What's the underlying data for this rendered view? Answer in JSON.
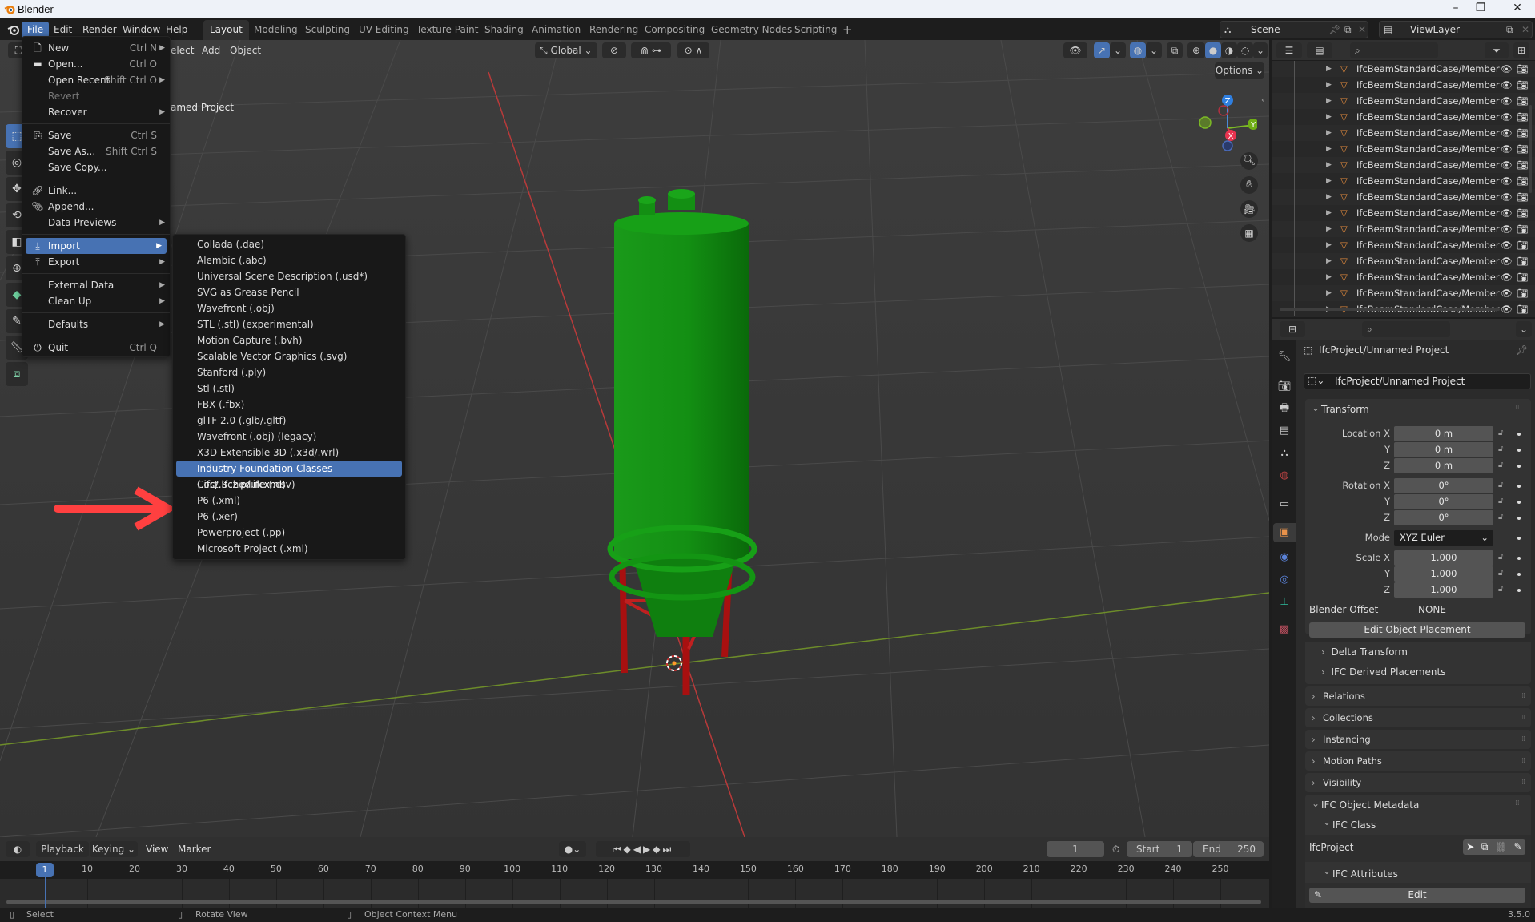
{
  "window": {
    "title": "Blender",
    "controls": {
      "minimize": "–",
      "maximize": "❐",
      "close": "✕"
    }
  },
  "topbar": {
    "menus": [
      "File",
      "Edit",
      "Render",
      "Window",
      "Help"
    ],
    "active_menu": "File",
    "workspaces": [
      "Layout",
      "Modeling",
      "Sculpting",
      "UV Editing",
      "Texture Paint",
      "Shading",
      "Animation",
      "Rendering",
      "Compositing",
      "Geometry Nodes",
      "Scripting"
    ],
    "active_workspace": "Layout",
    "add_workspace": "+",
    "scene": "Scene",
    "view_layer": "ViewLayer"
  },
  "viewport": {
    "header_menus": [
      "Select",
      "Add",
      "Object"
    ],
    "header_visible_menu_fragment": "elect",
    "transform_orientation": "Global",
    "options_label": "Options",
    "overlay_text": "amed Project",
    "gizmo_axes": {
      "z": "Z",
      "y": "Y",
      "x": "X"
    },
    "accent_color": "#4772b3"
  },
  "file_menu": {
    "items": [
      {
        "label": "New",
        "shortcut": "Ctrl N",
        "icon": "new-file-icon",
        "submenu": true
      },
      {
        "label": "Open...",
        "shortcut": "Ctrl O",
        "icon": "folder-icon"
      },
      {
        "label": "Open Recent",
        "shortcut": "Shift Ctrl O",
        "submenu": true
      },
      {
        "label": "Revert",
        "disabled": true
      },
      {
        "label": "Recover",
        "submenu": true
      },
      {
        "label": "Save",
        "shortcut": "Ctrl S",
        "icon": "save-icon"
      },
      {
        "label": "Save As...",
        "shortcut": "Shift Ctrl S"
      },
      {
        "label": "Save Copy..."
      },
      {
        "label": "Link...",
        "icon": "link-icon"
      },
      {
        "label": "Append...",
        "icon": "paperclip-icon"
      },
      {
        "label": "Data Previews",
        "submenu": true
      },
      {
        "label": "Import",
        "icon": "import-icon",
        "submenu": true,
        "highlighted": true
      },
      {
        "label": "Export",
        "icon": "export-icon",
        "submenu": true
      },
      {
        "label": "External Data",
        "submenu": true
      },
      {
        "label": "Clean Up",
        "submenu": true
      },
      {
        "label": "Defaults",
        "submenu": true
      },
      {
        "label": "Quit",
        "shortcut": "Ctrl Q",
        "icon": "power-icon"
      }
    ]
  },
  "import_menu": {
    "items": [
      "Collada (.dae)",
      "Alembic (.abc)",
      "Universal Scene Description (.usd*)",
      "SVG as Grease Pencil",
      "Wavefront (.obj)",
      "STL (.stl) (experimental)",
      "Motion Capture (.bvh)",
      "Scalable Vector Graphics (.svg)",
      "Stanford (.ply)",
      "Stl (.stl)",
      "FBX (.fbx)",
      "glTF 2.0 (.glb/.gltf)",
      "Wavefront (.obj) (legacy)",
      "X3D Extensible 3D (.x3d/.wrl)",
      "Industry Foundation Classes (.ifc/.ifczip/.ifcxml)",
      "Cost Schedule (.csv)",
      "P6 (.xml)",
      "P6 (.xer)",
      "Powerproject (.pp)",
      "Microsoft Project (.xml)"
    ],
    "highlighted_index": 14
  },
  "annotation": {
    "arrow_color": "#ff4040"
  },
  "outliner": {
    "rows": [
      "IfcBeamStandardCase/Member",
      "IfcBeamStandardCase/Member",
      "IfcBeamStandardCase/Member",
      "IfcBeamStandardCase/Member",
      "IfcBeamStandardCase/Member",
      "IfcBeamStandardCase/Member",
      "IfcBeamStandardCase/Member",
      "IfcBeamStandardCase/Member",
      "IfcBeamStandardCase/Member",
      "IfcBeamStandardCase/Member",
      "IfcBeamStandardCase/Member",
      "IfcBeamStandardCase/Member",
      "IfcBeamStandardCase/Member",
      "IfcBeamStandardCase/Member",
      "IfcBeamStandardCase/Member",
      "IfcBeamStandardCase/Member"
    ],
    "mesh_icon_color": "#e0893c"
  },
  "properties": {
    "context_title": "IfcProject/Unnamed Project",
    "object_name": "IfcProject/Unnamed Project",
    "transform": {
      "title": "Transform",
      "location_label": "Location X",
      "location": [
        "0 m",
        "0 m",
        "0 m"
      ],
      "rotation_label": "Rotation X",
      "rotation": [
        "0°",
        "0°",
        "0°"
      ],
      "mode_label": "Mode",
      "mode": "XYZ Euler",
      "scale_label": "Scale X",
      "scale": [
        "1.000",
        "1.000",
        "1.000"
      ],
      "axis_y": "Y",
      "axis_z": "Z",
      "blender_offset_label": "Blender Offset",
      "blender_offset_value": "NONE",
      "edit_placement_button": "Edit Object Placement",
      "subpanels": [
        "Delta Transform",
        "IFC Derived Placements"
      ]
    },
    "panels": [
      "Relations",
      "Collections",
      "Instancing",
      "Motion Paths",
      "Visibility"
    ],
    "ifc_metadata": {
      "title": "IFC Object Metadata",
      "class_title": "IFC Class",
      "class_value": "IfcProject",
      "attributes_title": "IFC Attributes",
      "edit_button": "Edit"
    }
  },
  "timeline": {
    "menus": [
      "Playback",
      "Keying",
      "View",
      "Marker"
    ],
    "current_frame": "1",
    "start_label": "Start",
    "start": "1",
    "end_label": "End",
    "end": "250",
    "ticks": [
      "10",
      "20",
      "30",
      "40",
      "50",
      "60",
      "70",
      "80",
      "90",
      "100",
      "110",
      "120",
      "130",
      "140",
      "150",
      "160",
      "170",
      "180",
      "190",
      "200",
      "210",
      "220",
      "230",
      "240",
      "250"
    ],
    "playhead_frame": "1"
  },
  "statusbar": {
    "hints": [
      "Select",
      "Rotate View",
      "Object Context Menu"
    ],
    "version": "3.5.0"
  }
}
